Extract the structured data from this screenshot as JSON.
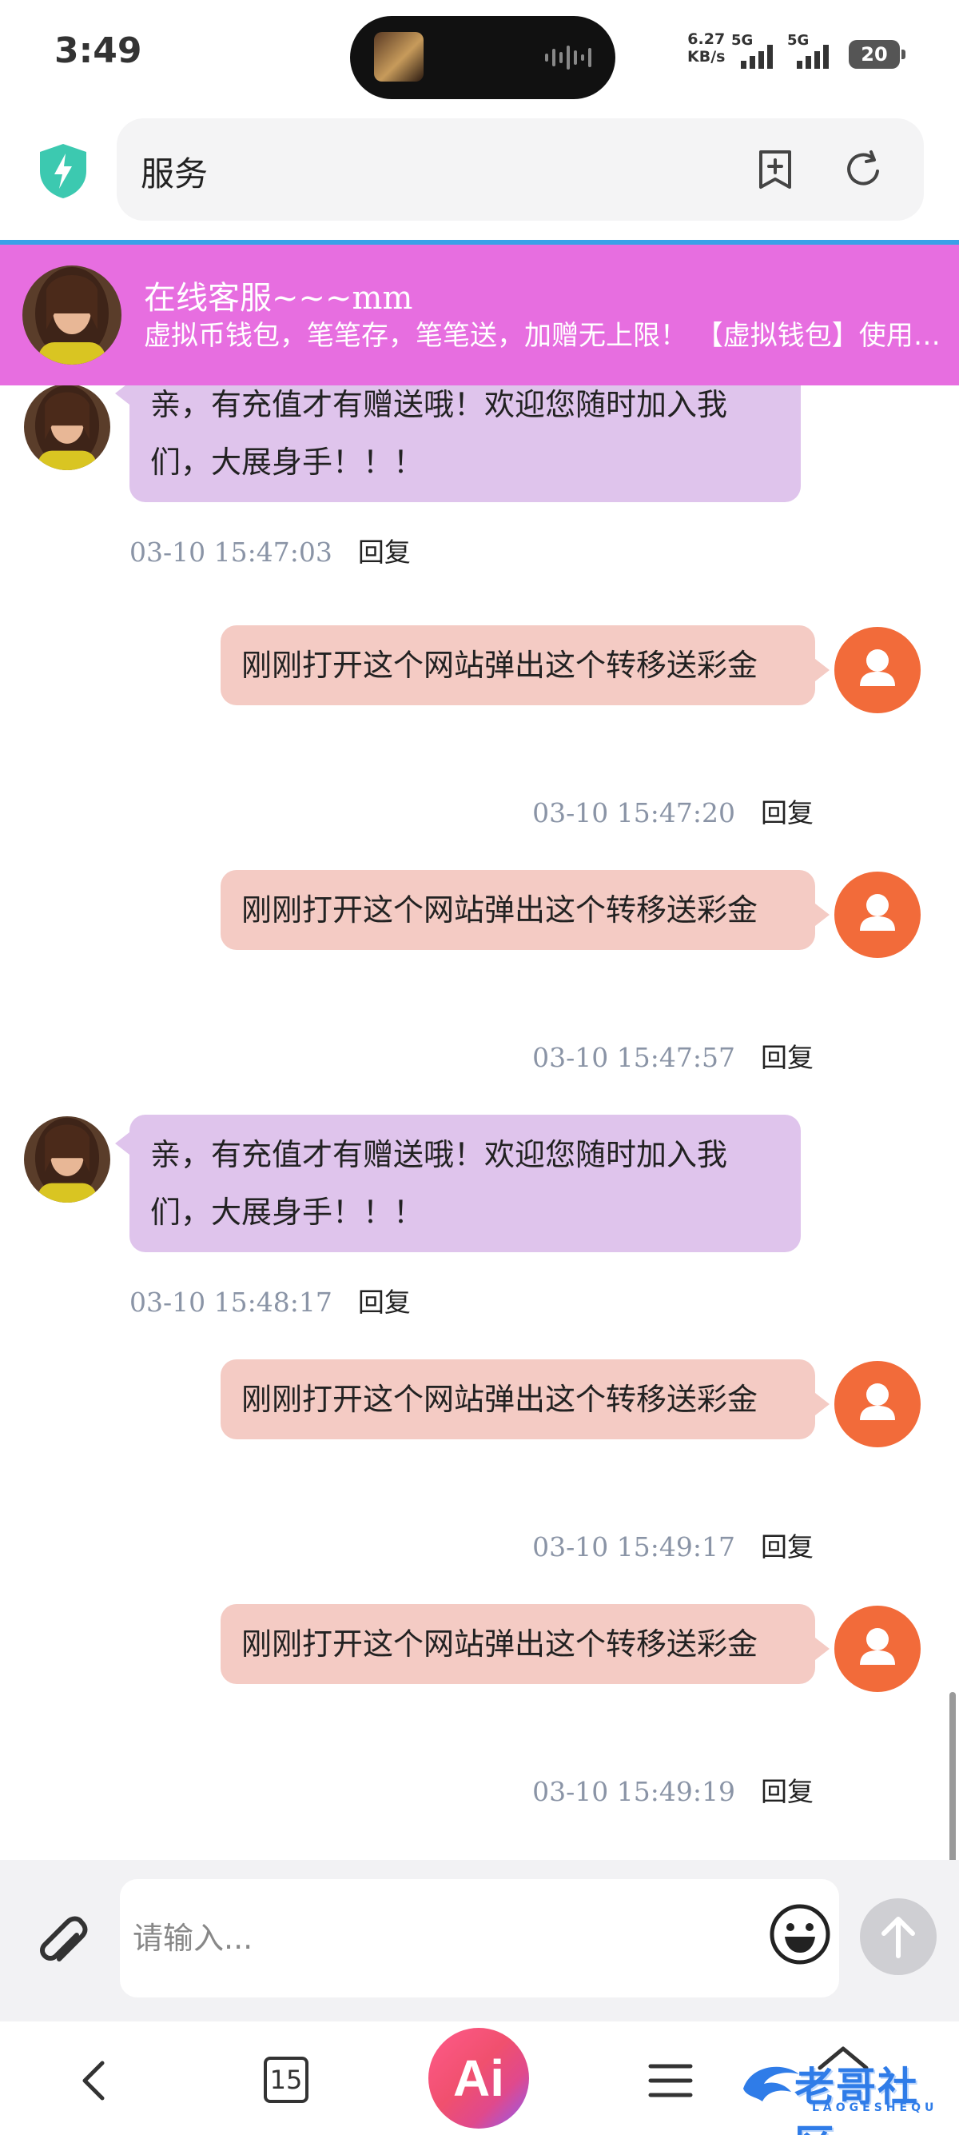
{
  "status_bar": {
    "time": "3:49",
    "net_speed_value": "6.27",
    "net_speed_unit": "KB/s",
    "sim1_label": "5G",
    "sim2_label": "5G",
    "battery": "20"
  },
  "browser": {
    "url_text": "服务",
    "shield_icon": "shield-bolt-icon",
    "bookmark_icon": "bookmark-add-icon",
    "reload_icon": "reload-icon"
  },
  "chat_header": {
    "title": "在线客服~~~mm",
    "subtitle": "虚拟币钱包，笔笔存，笔笔送，加赠无上限！ 【虚拟钱包】使用教程"
  },
  "messages": [
    {
      "sender": "agent",
      "text": "亲，有充值才有赠送哦！欢迎您随时加入我们，大展身手！！！",
      "timestamp": "03-10 15:47:03",
      "reply_label": "回复"
    },
    {
      "sender": "user",
      "text": "刚刚打开这个网站弹出这个转移送彩金",
      "timestamp": "03-10 15:47:20",
      "reply_label": "回复"
    },
    {
      "sender": "user",
      "text": "刚刚打开这个网站弹出这个转移送彩金",
      "timestamp": "03-10 15:47:57",
      "reply_label": "回复"
    },
    {
      "sender": "agent",
      "text": "亲，有充值才有赠送哦！欢迎您随时加入我们，大展身手！！！",
      "timestamp": "03-10 15:48:17",
      "reply_label": "回复"
    },
    {
      "sender": "user",
      "text": "刚刚打开这个网站弹出这个转移送彩金",
      "timestamp": "03-10 15:49:17",
      "reply_label": "回复"
    },
    {
      "sender": "user",
      "text": "刚刚打开这个网站弹出这个转移送彩金",
      "timestamp": "03-10 15:49:19",
      "reply_label": "回复"
    }
  ],
  "input": {
    "placeholder": "请输入...",
    "value": ""
  },
  "bottom_nav": {
    "tab_count": "15",
    "ai_label": "Ai",
    "logo_text": "老哥社区",
    "logo_sub": "LAOGESHEQU"
  },
  "colors": {
    "header_bg": "#e76ee0",
    "agent_bubble": "#dfc4ec",
    "user_bubble": "#f4cbc4",
    "user_avatar": "#f26b3a",
    "timestamp": "#8a94a6"
  }
}
